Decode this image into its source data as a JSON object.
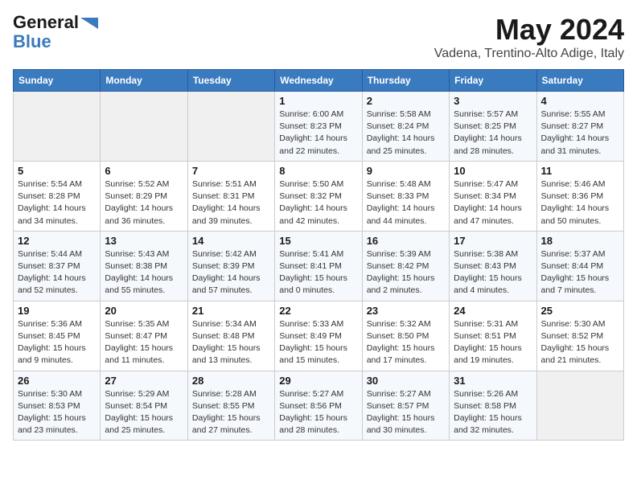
{
  "logo": {
    "general": "General",
    "blue": "Blue",
    "arrow_color": "#3a7abf"
  },
  "title": "May 2024",
  "location": "Vadena, Trentino-Alto Adige, Italy",
  "days_of_week": [
    "Sunday",
    "Monday",
    "Tuesday",
    "Wednesday",
    "Thursday",
    "Friday",
    "Saturday"
  ],
  "weeks": [
    [
      {
        "day": "",
        "info": ""
      },
      {
        "day": "",
        "info": ""
      },
      {
        "day": "",
        "info": ""
      },
      {
        "day": "1",
        "info": "Sunrise: 6:00 AM\nSunset: 8:23 PM\nDaylight: 14 hours\nand 22 minutes."
      },
      {
        "day": "2",
        "info": "Sunrise: 5:58 AM\nSunset: 8:24 PM\nDaylight: 14 hours\nand 25 minutes."
      },
      {
        "day": "3",
        "info": "Sunrise: 5:57 AM\nSunset: 8:25 PM\nDaylight: 14 hours\nand 28 minutes."
      },
      {
        "day": "4",
        "info": "Sunrise: 5:55 AM\nSunset: 8:27 PM\nDaylight: 14 hours\nand 31 minutes."
      }
    ],
    [
      {
        "day": "5",
        "info": "Sunrise: 5:54 AM\nSunset: 8:28 PM\nDaylight: 14 hours\nand 34 minutes."
      },
      {
        "day": "6",
        "info": "Sunrise: 5:52 AM\nSunset: 8:29 PM\nDaylight: 14 hours\nand 36 minutes."
      },
      {
        "day": "7",
        "info": "Sunrise: 5:51 AM\nSunset: 8:31 PM\nDaylight: 14 hours\nand 39 minutes."
      },
      {
        "day": "8",
        "info": "Sunrise: 5:50 AM\nSunset: 8:32 PM\nDaylight: 14 hours\nand 42 minutes."
      },
      {
        "day": "9",
        "info": "Sunrise: 5:48 AM\nSunset: 8:33 PM\nDaylight: 14 hours\nand 44 minutes."
      },
      {
        "day": "10",
        "info": "Sunrise: 5:47 AM\nSunset: 8:34 PM\nDaylight: 14 hours\nand 47 minutes."
      },
      {
        "day": "11",
        "info": "Sunrise: 5:46 AM\nSunset: 8:36 PM\nDaylight: 14 hours\nand 50 minutes."
      }
    ],
    [
      {
        "day": "12",
        "info": "Sunrise: 5:44 AM\nSunset: 8:37 PM\nDaylight: 14 hours\nand 52 minutes."
      },
      {
        "day": "13",
        "info": "Sunrise: 5:43 AM\nSunset: 8:38 PM\nDaylight: 14 hours\nand 55 minutes."
      },
      {
        "day": "14",
        "info": "Sunrise: 5:42 AM\nSunset: 8:39 PM\nDaylight: 14 hours\nand 57 minutes."
      },
      {
        "day": "15",
        "info": "Sunrise: 5:41 AM\nSunset: 8:41 PM\nDaylight: 15 hours\nand 0 minutes."
      },
      {
        "day": "16",
        "info": "Sunrise: 5:39 AM\nSunset: 8:42 PM\nDaylight: 15 hours\nand 2 minutes."
      },
      {
        "day": "17",
        "info": "Sunrise: 5:38 AM\nSunset: 8:43 PM\nDaylight: 15 hours\nand 4 minutes."
      },
      {
        "day": "18",
        "info": "Sunrise: 5:37 AM\nSunset: 8:44 PM\nDaylight: 15 hours\nand 7 minutes."
      }
    ],
    [
      {
        "day": "19",
        "info": "Sunrise: 5:36 AM\nSunset: 8:45 PM\nDaylight: 15 hours\nand 9 minutes."
      },
      {
        "day": "20",
        "info": "Sunrise: 5:35 AM\nSunset: 8:47 PM\nDaylight: 15 hours\nand 11 minutes."
      },
      {
        "day": "21",
        "info": "Sunrise: 5:34 AM\nSunset: 8:48 PM\nDaylight: 15 hours\nand 13 minutes."
      },
      {
        "day": "22",
        "info": "Sunrise: 5:33 AM\nSunset: 8:49 PM\nDaylight: 15 hours\nand 15 minutes."
      },
      {
        "day": "23",
        "info": "Sunrise: 5:32 AM\nSunset: 8:50 PM\nDaylight: 15 hours\nand 17 minutes."
      },
      {
        "day": "24",
        "info": "Sunrise: 5:31 AM\nSunset: 8:51 PM\nDaylight: 15 hours\nand 19 minutes."
      },
      {
        "day": "25",
        "info": "Sunrise: 5:30 AM\nSunset: 8:52 PM\nDaylight: 15 hours\nand 21 minutes."
      }
    ],
    [
      {
        "day": "26",
        "info": "Sunrise: 5:30 AM\nSunset: 8:53 PM\nDaylight: 15 hours\nand 23 minutes."
      },
      {
        "day": "27",
        "info": "Sunrise: 5:29 AM\nSunset: 8:54 PM\nDaylight: 15 hours\nand 25 minutes."
      },
      {
        "day": "28",
        "info": "Sunrise: 5:28 AM\nSunset: 8:55 PM\nDaylight: 15 hours\nand 27 minutes."
      },
      {
        "day": "29",
        "info": "Sunrise: 5:27 AM\nSunset: 8:56 PM\nDaylight: 15 hours\nand 28 minutes."
      },
      {
        "day": "30",
        "info": "Sunrise: 5:27 AM\nSunset: 8:57 PM\nDaylight: 15 hours\nand 30 minutes."
      },
      {
        "day": "31",
        "info": "Sunrise: 5:26 AM\nSunset: 8:58 PM\nDaylight: 15 hours\nand 32 minutes."
      },
      {
        "day": "",
        "info": ""
      }
    ]
  ]
}
